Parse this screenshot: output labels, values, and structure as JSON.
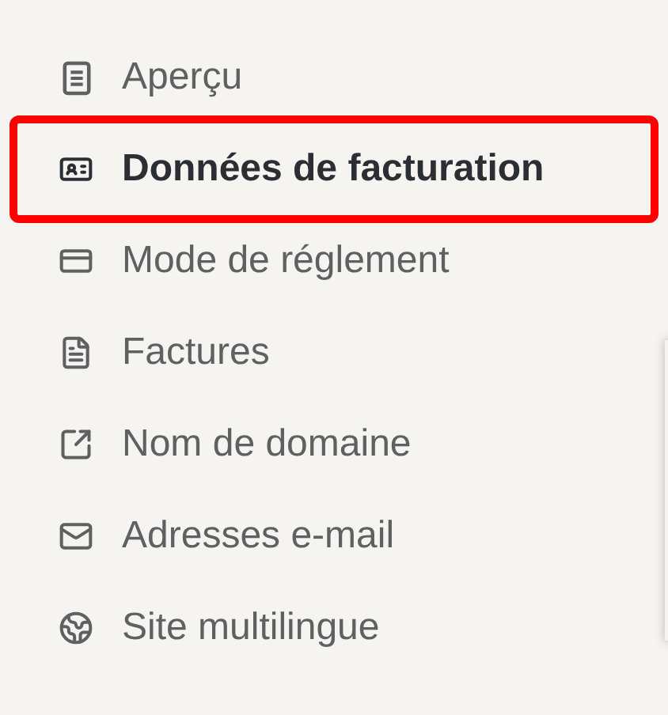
{
  "menu": {
    "items": [
      {
        "label": "Aperçu",
        "selected": false
      },
      {
        "label": "Données de facturation",
        "selected": true
      },
      {
        "label": "Mode de réglement",
        "selected": false
      },
      {
        "label": "Factures",
        "selected": false
      },
      {
        "label": "Nom de domaine",
        "selected": false
      },
      {
        "label": "Adresses e-mail",
        "selected": false
      },
      {
        "label": "Site multilingue",
        "selected": false
      }
    ]
  }
}
